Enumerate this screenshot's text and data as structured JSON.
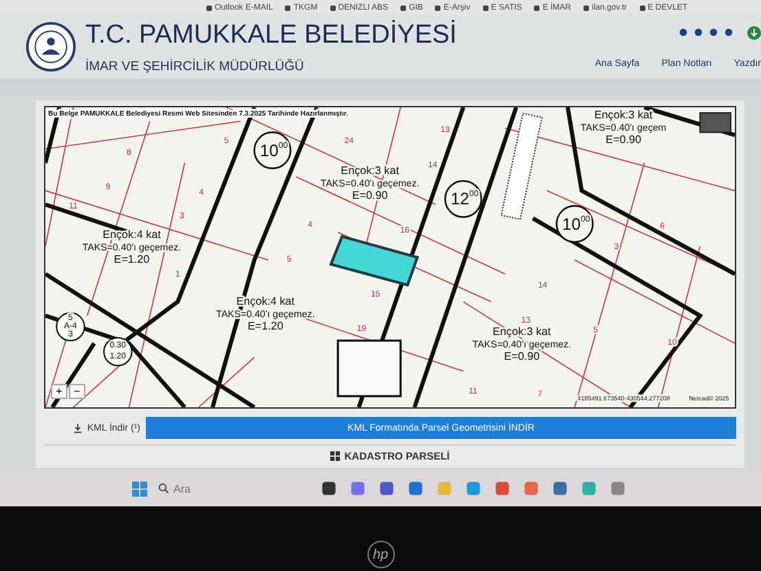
{
  "bookmarks": [
    "Outlook E-MAIL",
    "TKGM",
    "DENIZLI ABS",
    "GIB",
    "E-Arşiv",
    "E SATIS",
    "E İMAR",
    "ilan.gov.tr",
    "E DEVLET"
  ],
  "header": {
    "title": "T.C. PAMUKKALE BELEDİYESİ",
    "subtitle": "İMAR VE ŞEHİRCİLİK MÜDÜRLÜĞÜ",
    "nav": [
      "Ana Sayfa",
      "Plan Notları",
      "Yazdır"
    ]
  },
  "map": {
    "notice": "Bu Belge PAMUKKALE Belediyesi Resmi Web Sitesinden 7.3.2025 Tarihinde Hazırlanmıştır.",
    "notes": [
      {
        "lines": [
          "Ençok:3 kat",
          "TAKS=0.40'ı geçemez.",
          "E=0.90"
        ]
      },
      {
        "lines": [
          "Ençok:3 kat",
          "TAKS=0.40'ı geçem",
          "E=0.90"
        ]
      },
      {
        "lines": [
          "Ençok:4 kat",
          "TAKS=0.40'ı geçemez.",
          "E=1.20"
        ]
      },
      {
        "lines": [
          "Ençok:4 kat",
          "TAKS=0.40'ı geçemez.",
          "E=1.20"
        ]
      },
      {
        "lines": [
          "Ençok:3 kat",
          "TAKS=0.40'ı geçemez.",
          "E=0.90"
        ]
      }
    ],
    "parcels": [
      "8",
      "5",
      "24",
      "13",
      "14",
      "9",
      "4",
      "11",
      "3",
      "1",
      "4",
      "16",
      "5",
      "15",
      "19",
      "6",
      "3",
      "14",
      "13",
      "5",
      "10",
      "11",
      "7"
    ],
    "elevations": [
      {
        "value": "10",
        "raised": "00"
      },
      {
        "value": "12",
        "raised": "00"
      },
      {
        "value": "10",
        "raised": "00"
      }
    ],
    "legend": [
      {
        "lines": [
          "5",
          "A-4",
          "3"
        ]
      },
      {
        "lines": [
          "0.30",
          "1.20"
        ]
      }
    ],
    "zoom": [
      "+",
      "−"
    ],
    "coordinates": "4185491.673540-430544.277208",
    "attribution": "Netcad© 2025"
  },
  "kml": {
    "label": "KML İndir (¹)",
    "button": "KML Formatında Parsel Geometrisini İNDİR"
  },
  "section": {
    "title": "KADASTRO PARSELİ"
  },
  "taskbar": {
    "search_placeholder": "Ara"
  },
  "bezel_logo": "hp"
}
